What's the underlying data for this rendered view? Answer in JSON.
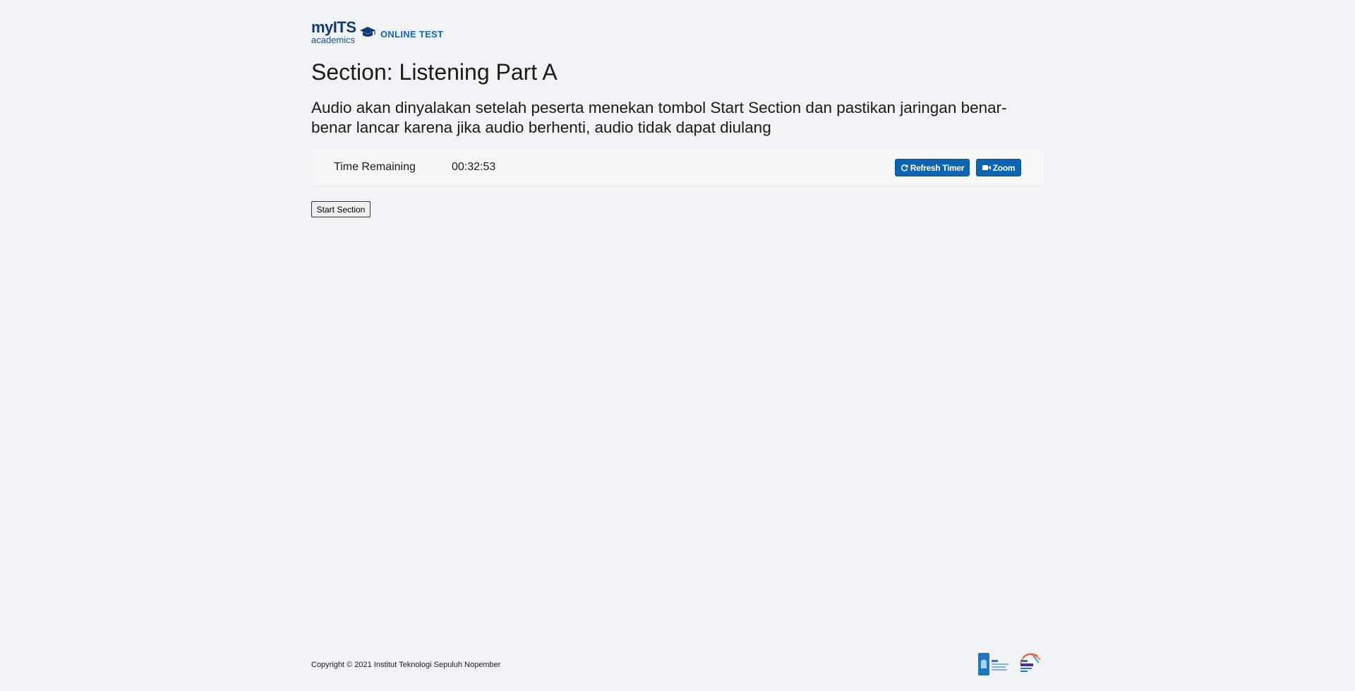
{
  "brand": {
    "logo_main": "myITS",
    "logo_sub": "academics",
    "product": "ONLINE TEST"
  },
  "page": {
    "section_title": "Section: Listening Part A",
    "instruction": "Audio akan dinyalakan setelah peserta menekan tombol Start Section dan pastikan jaringan benar-benar lancar karena jika audio berhenti, audio tidak dapat diulang"
  },
  "timer": {
    "label": "Time Remaining",
    "value": "00:32:53",
    "refresh_label": "Refresh Timer",
    "zoom_label": "Zoom"
  },
  "actions": {
    "start_label": "Start Section"
  },
  "footer": {
    "copyright": "Copyright © 2021 Institut Teknologi Sepuluh Nopember"
  },
  "icons": {
    "refresh": "refresh-icon",
    "zoom": "video-camera-icon",
    "logo_cap": "graduation-cap-icon"
  },
  "colors": {
    "background": "#f0f2f5",
    "brand_dark": "#0f3a78",
    "brand_accent": "#1565b8",
    "button_primary": "#0d64b0"
  }
}
